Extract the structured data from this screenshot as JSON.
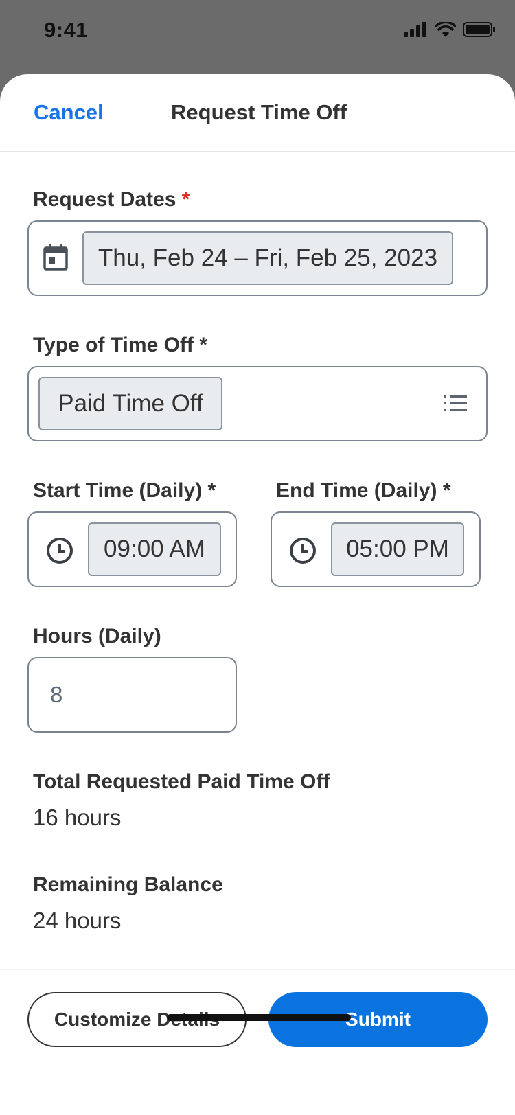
{
  "status_bar": {
    "time": "9:41",
    "icons": [
      "signal-icon",
      "wifi-icon",
      "battery-icon"
    ]
  },
  "header": {
    "cancel_label": "Cancel",
    "title": "Request Time Off"
  },
  "form": {
    "request_dates": {
      "label": "Request Dates",
      "required_marker": "*",
      "value": "Thu, Feb 24 – Fri, Feb 25, 2023",
      "icon": "calendar-icon"
    },
    "type_of_time_off": {
      "label": "Type of Time Off *",
      "value": "Paid Time Off",
      "icon": "list-icon"
    },
    "start_time": {
      "label": "Start Time (Daily) *",
      "value": "09:00 AM",
      "icon": "clock-icon"
    },
    "end_time": {
      "label": "End Time (Daily) *",
      "value": "05:00 PM",
      "icon": "clock-icon"
    },
    "hours": {
      "label": "Hours (Daily)",
      "value": "8"
    }
  },
  "summary": {
    "total_label": "Total Requested Paid Time Off",
    "total_value": "16 hours",
    "balance_label": "Remaining Balance",
    "balance_value": "24 hours"
  },
  "footer": {
    "customize_label": "Customize Details",
    "submit_label": "Submit"
  },
  "colors": {
    "accent": "#0b73e0",
    "link": "#1a73e8",
    "required": "#de2e21",
    "status_bar_bg": "#6b6b6b"
  }
}
